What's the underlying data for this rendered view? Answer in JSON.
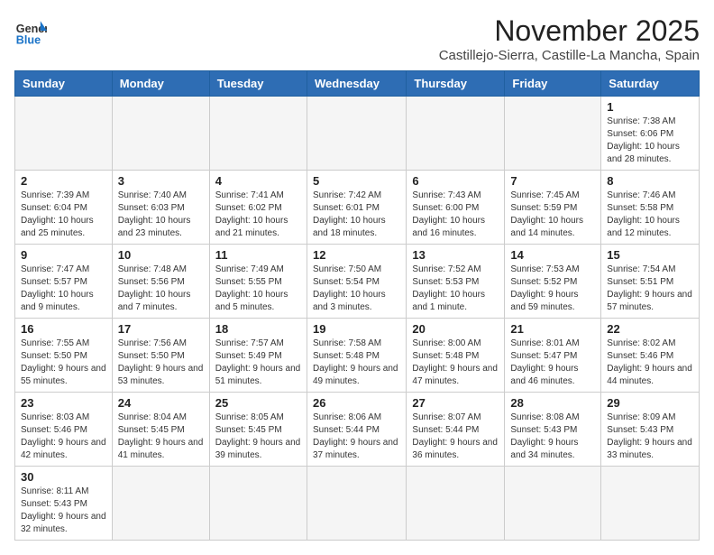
{
  "logo": {
    "line1": "General",
    "line2": "Blue"
  },
  "header": {
    "month": "November 2025",
    "location": "Castillejo-Sierra, Castille-La Mancha, Spain"
  },
  "weekdays": [
    "Sunday",
    "Monday",
    "Tuesday",
    "Wednesday",
    "Thursday",
    "Friday",
    "Saturday"
  ],
  "weeks": [
    [
      {
        "day": "",
        "info": ""
      },
      {
        "day": "",
        "info": ""
      },
      {
        "day": "",
        "info": ""
      },
      {
        "day": "",
        "info": ""
      },
      {
        "day": "",
        "info": ""
      },
      {
        "day": "",
        "info": ""
      },
      {
        "day": "1",
        "info": "Sunrise: 7:38 AM\nSunset: 6:06 PM\nDaylight: 10 hours and 28 minutes."
      }
    ],
    [
      {
        "day": "2",
        "info": "Sunrise: 7:39 AM\nSunset: 6:04 PM\nDaylight: 10 hours and 25 minutes."
      },
      {
        "day": "3",
        "info": "Sunrise: 7:40 AM\nSunset: 6:03 PM\nDaylight: 10 hours and 23 minutes."
      },
      {
        "day": "4",
        "info": "Sunrise: 7:41 AM\nSunset: 6:02 PM\nDaylight: 10 hours and 21 minutes."
      },
      {
        "day": "5",
        "info": "Sunrise: 7:42 AM\nSunset: 6:01 PM\nDaylight: 10 hours and 18 minutes."
      },
      {
        "day": "6",
        "info": "Sunrise: 7:43 AM\nSunset: 6:00 PM\nDaylight: 10 hours and 16 minutes."
      },
      {
        "day": "7",
        "info": "Sunrise: 7:45 AM\nSunset: 5:59 PM\nDaylight: 10 hours and 14 minutes."
      },
      {
        "day": "8",
        "info": "Sunrise: 7:46 AM\nSunset: 5:58 PM\nDaylight: 10 hours and 12 minutes."
      }
    ],
    [
      {
        "day": "9",
        "info": "Sunrise: 7:47 AM\nSunset: 5:57 PM\nDaylight: 10 hours and 9 minutes."
      },
      {
        "day": "10",
        "info": "Sunrise: 7:48 AM\nSunset: 5:56 PM\nDaylight: 10 hours and 7 minutes."
      },
      {
        "day": "11",
        "info": "Sunrise: 7:49 AM\nSunset: 5:55 PM\nDaylight: 10 hours and 5 minutes."
      },
      {
        "day": "12",
        "info": "Sunrise: 7:50 AM\nSunset: 5:54 PM\nDaylight: 10 hours and 3 minutes."
      },
      {
        "day": "13",
        "info": "Sunrise: 7:52 AM\nSunset: 5:53 PM\nDaylight: 10 hours and 1 minute."
      },
      {
        "day": "14",
        "info": "Sunrise: 7:53 AM\nSunset: 5:52 PM\nDaylight: 9 hours and 59 minutes."
      },
      {
        "day": "15",
        "info": "Sunrise: 7:54 AM\nSunset: 5:51 PM\nDaylight: 9 hours and 57 minutes."
      }
    ],
    [
      {
        "day": "16",
        "info": "Sunrise: 7:55 AM\nSunset: 5:50 PM\nDaylight: 9 hours and 55 minutes."
      },
      {
        "day": "17",
        "info": "Sunrise: 7:56 AM\nSunset: 5:50 PM\nDaylight: 9 hours and 53 minutes."
      },
      {
        "day": "18",
        "info": "Sunrise: 7:57 AM\nSunset: 5:49 PM\nDaylight: 9 hours and 51 minutes."
      },
      {
        "day": "19",
        "info": "Sunrise: 7:58 AM\nSunset: 5:48 PM\nDaylight: 9 hours and 49 minutes."
      },
      {
        "day": "20",
        "info": "Sunrise: 8:00 AM\nSunset: 5:48 PM\nDaylight: 9 hours and 47 minutes."
      },
      {
        "day": "21",
        "info": "Sunrise: 8:01 AM\nSunset: 5:47 PM\nDaylight: 9 hours and 46 minutes."
      },
      {
        "day": "22",
        "info": "Sunrise: 8:02 AM\nSunset: 5:46 PM\nDaylight: 9 hours and 44 minutes."
      }
    ],
    [
      {
        "day": "23",
        "info": "Sunrise: 8:03 AM\nSunset: 5:46 PM\nDaylight: 9 hours and 42 minutes."
      },
      {
        "day": "24",
        "info": "Sunrise: 8:04 AM\nSunset: 5:45 PM\nDaylight: 9 hours and 41 minutes."
      },
      {
        "day": "25",
        "info": "Sunrise: 8:05 AM\nSunset: 5:45 PM\nDaylight: 9 hours and 39 minutes."
      },
      {
        "day": "26",
        "info": "Sunrise: 8:06 AM\nSunset: 5:44 PM\nDaylight: 9 hours and 37 minutes."
      },
      {
        "day": "27",
        "info": "Sunrise: 8:07 AM\nSunset: 5:44 PM\nDaylight: 9 hours and 36 minutes."
      },
      {
        "day": "28",
        "info": "Sunrise: 8:08 AM\nSunset: 5:43 PM\nDaylight: 9 hours and 34 minutes."
      },
      {
        "day": "29",
        "info": "Sunrise: 8:09 AM\nSunset: 5:43 PM\nDaylight: 9 hours and 33 minutes."
      }
    ],
    [
      {
        "day": "30",
        "info": "Sunrise: 8:11 AM\nSunset: 5:43 PM\nDaylight: 9 hours and 32 minutes."
      },
      {
        "day": "",
        "info": ""
      },
      {
        "day": "",
        "info": ""
      },
      {
        "day": "",
        "info": ""
      },
      {
        "day": "",
        "info": ""
      },
      {
        "day": "",
        "info": ""
      },
      {
        "day": "",
        "info": ""
      }
    ]
  ]
}
